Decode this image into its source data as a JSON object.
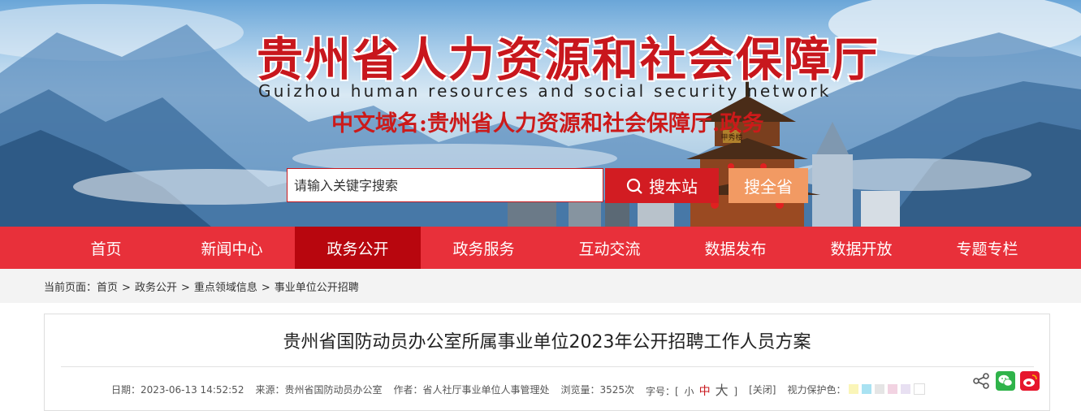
{
  "header": {
    "title": "贵州省人力资源和社会保障厅",
    "subtitle": "Guizhou human resources and social security network",
    "domain_name": "中文域名:贵州省人力资源和社会保障厅.政务",
    "tower_sign": "甲秀楼"
  },
  "search": {
    "placeholder": "请输入关键字搜索",
    "site_button": "搜本站",
    "province_button": "搜全省",
    "site_icon": "search-icon"
  },
  "nav": {
    "items": [
      "首页",
      "新闻中心",
      "政务公开",
      "政务服务",
      "互动交流",
      "数据发布",
      "数据开放",
      "专题专栏"
    ],
    "active": "政务公开"
  },
  "breadcrumb": {
    "label": "当前页面：",
    "items": [
      "首页",
      "政务公开",
      "重点领域信息",
      "事业单位公开招聘"
    ],
    "separator": ">"
  },
  "article": {
    "title": "贵州省国防动员办公室所属事业单位2023年公开招聘工作人员方案",
    "date": "日期：2023-06-13 14:52:52",
    "source": "来源：贵州省国防动员办公室",
    "author": "作者：省人社厅事业单位人事管理处",
    "views": "浏览量：3525次",
    "font_size_label": "字号：[",
    "font_small": "小",
    "font_medium": "中",
    "font_large": "大",
    "font_size_end": "]",
    "close": "[关闭]",
    "eye_care_label": "视力保护色：",
    "eye_care_colors": [
      "#faf5b8",
      "#a9e2f2",
      "#e5e5e5",
      "#f2d3e2",
      "#e8e0f2",
      "#ffffff"
    ],
    "share_icons": [
      "share-icon",
      "wechat-icon",
      "weibo-icon"
    ]
  },
  "colors": {
    "brand_red": "#e8303a",
    "nav_active": "#b8060e",
    "title_red": "#c8171d",
    "province_button": "#f29a63"
  }
}
